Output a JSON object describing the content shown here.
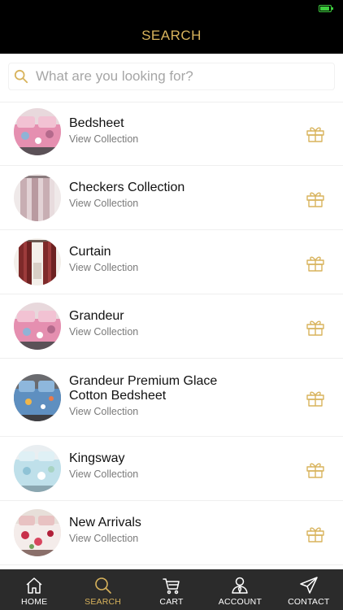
{
  "header": {
    "title": "SEARCH"
  },
  "search": {
    "placeholder": "What are you looking for?"
  },
  "collections": [
    {
      "title": "Bedsheet",
      "subtitle": "View Collection",
      "icon": "gift-icon"
    },
    {
      "title": "Checkers Collection",
      "subtitle": "View Collection",
      "icon": "gift-icon"
    },
    {
      "title": "Curtain",
      "subtitle": "View Collection",
      "icon": "gift-icon"
    },
    {
      "title": "Grandeur",
      "subtitle": "View Collection",
      "icon": "gift-icon"
    },
    {
      "title": "Grandeur Premium Glace Cotton Bedsheet",
      "subtitle": "View Collection",
      "icon": "gift-icon"
    },
    {
      "title": "Kingsway",
      "subtitle": "View Collection",
      "icon": "gift-icon"
    },
    {
      "title": "New Arrivals",
      "subtitle": "View Collection",
      "icon": "gift-icon"
    }
  ],
  "tabs": [
    {
      "label": "HOME",
      "icon": "home-icon",
      "active": false
    },
    {
      "label": "SEARCH",
      "icon": "search-icon",
      "active": true
    },
    {
      "label": "CART",
      "icon": "cart-icon",
      "active": false
    },
    {
      "label": "ACCOUNT",
      "icon": "account-icon",
      "active": false
    },
    {
      "label": "CONTACT",
      "icon": "paper-plane-icon",
      "active": false
    }
  ],
  "colors": {
    "accent": "#d8b35c",
    "header_bg": "#000000",
    "tabbar_bg": "#2b2b2b"
  }
}
